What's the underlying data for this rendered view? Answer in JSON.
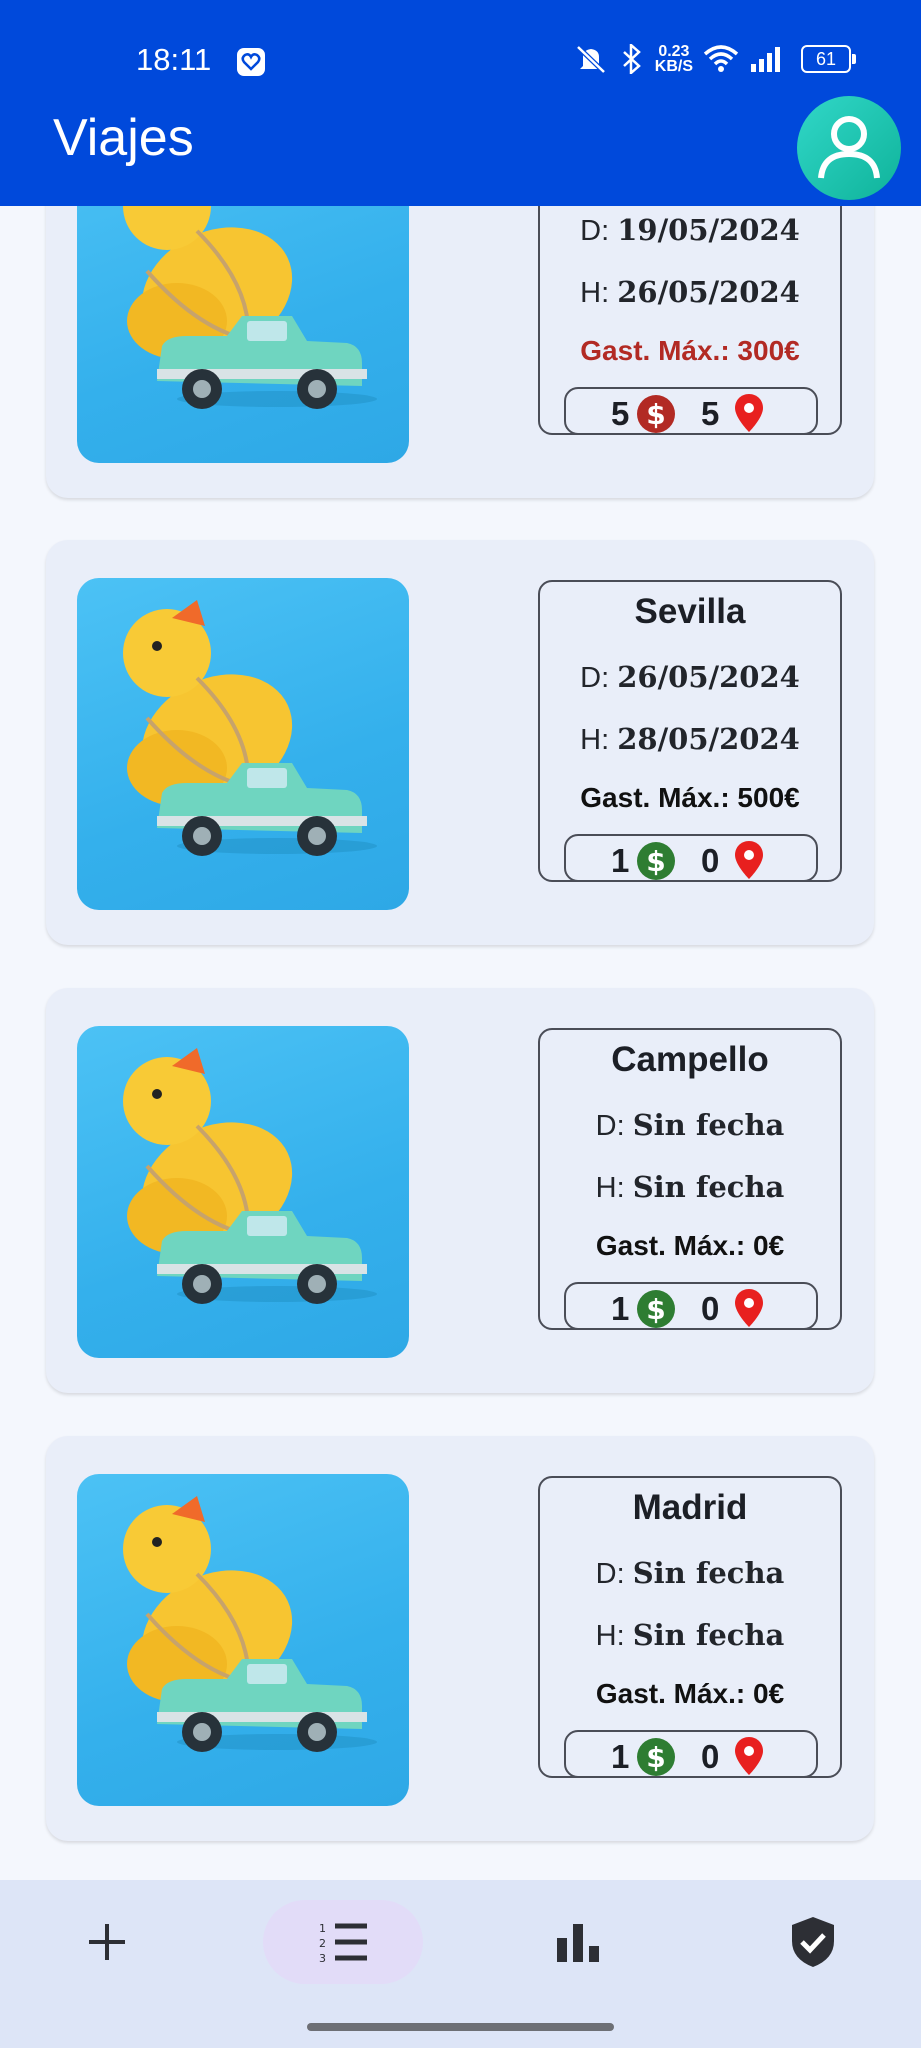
{
  "status_bar": {
    "time": "18:11",
    "net_speed_value": "0.23",
    "net_speed_unit": "KB/S",
    "battery": "61"
  },
  "app_bar": {
    "title": "Viajes",
    "profile_icon": "person-icon"
  },
  "trips": [
    {
      "city": "",
      "from_label": "D:",
      "from": "19/05/2024",
      "to_label": "H:",
      "to": "26/05/2024",
      "max_spend": "Gast. Máx.: 300€",
      "over_budget": true,
      "expenses": "5",
      "places": "5",
      "expense_icon_color": "#b22a24"
    },
    {
      "city": "Sevilla",
      "from_label": "D:",
      "from": "26/05/2024",
      "to_label": "H:",
      "to": "28/05/2024",
      "max_spend": "Gast. Máx.: 500€",
      "over_budget": false,
      "expenses": "1",
      "places": "0",
      "expense_icon_color": "#2e7d32"
    },
    {
      "city": "Campello",
      "from_label": "D:",
      "from": "Sin fecha",
      "to_label": "H:",
      "to": "Sin fecha",
      "max_spend": "Gast. Máx.: 0€",
      "over_budget": false,
      "expenses": "1",
      "places": "0",
      "expense_icon_color": "#2e7d32"
    },
    {
      "city": "Madrid",
      "from_label": "D:",
      "from": "Sin fecha",
      "to_label": "H:",
      "to": "Sin fecha",
      "max_spend": "Gast. Máx.: 0€",
      "over_budget": false,
      "expenses": "1",
      "places": "0",
      "expense_icon_color": "#2e7d32"
    }
  ],
  "bottom_nav": [
    {
      "name": "add",
      "icon": "plus-icon",
      "active": false
    },
    {
      "name": "list",
      "icon": "numbered-list-icon",
      "active": true
    },
    {
      "name": "stats",
      "icon": "bar-chart-icon",
      "active": false
    },
    {
      "name": "security",
      "icon": "shield-check-icon",
      "active": false
    }
  ],
  "colors": {
    "app_bar": "#0049db",
    "over_budget": "#b22a24",
    "pin": "#e8201f",
    "dollar_ok": "#2e7d32"
  }
}
